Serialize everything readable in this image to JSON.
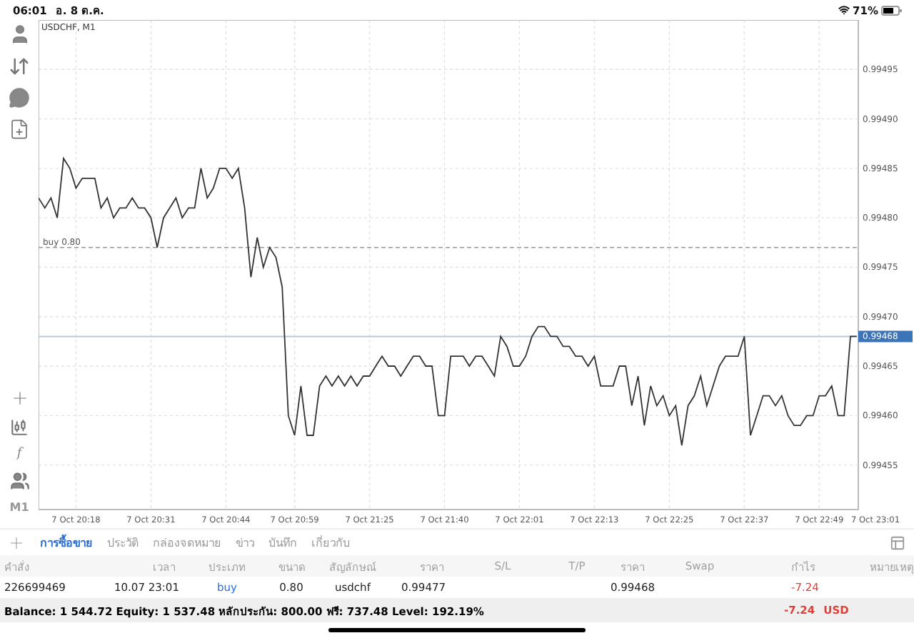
{
  "status_bar": {
    "time": "06:01",
    "date": "อ. 8 ต.ค.",
    "battery": "71%"
  },
  "toolbar": {
    "function_glyph": "f",
    "timeframe": "M1"
  },
  "chart": {
    "chart_data": {
      "type": "line",
      "title": "USDCHF, M1",
      "grid": true,
      "ylim": [
        0.994505,
        0.995
      ],
      "categories": [
        null,
        null,
        null,
        null,
        null,
        null,
        "7 Oct 20:18",
        null,
        null,
        null,
        null,
        null,
        null,
        null,
        null,
        null,
        null,
        null,
        "7 Oct 20:31",
        null,
        null,
        null,
        null,
        null,
        null,
        null,
        null,
        null,
        null,
        null,
        "7 Oct 20:44",
        null,
        null,
        null,
        null,
        null,
        null,
        null,
        null,
        null,
        null,
        "7 Oct 20:59",
        null,
        null,
        null,
        null,
        null,
        null,
        null,
        null,
        null,
        null,
        null,
        "7 Oct 21:25",
        null,
        null,
        null,
        null,
        null,
        null,
        null,
        null,
        null,
        null,
        null,
        "7 Oct 21:40",
        null,
        null,
        null,
        null,
        null,
        null,
        null,
        null,
        null,
        null,
        null,
        "7 Oct 22:01",
        null,
        null,
        null,
        null,
        null,
        null,
        null,
        null,
        null,
        null,
        null,
        "7 Oct 22:13",
        null,
        null,
        null,
        null,
        null,
        null,
        null,
        null,
        null,
        null,
        null,
        "7 Oct 22:25",
        null,
        null,
        null,
        null,
        null,
        null,
        null,
        null,
        null,
        null,
        null,
        "7 Oct 22:37",
        null,
        null,
        null,
        null,
        null,
        null,
        null,
        null,
        null,
        null,
        null,
        "7 Oct 22:49",
        null,
        null,
        null,
        null,
        null,
        null,
        null,
        null,
        "7 Oct 23:01"
      ],
      "yticks": [
        {
          "value": 0.99455,
          "label": "0.99455"
        },
        {
          "value": 0.9946,
          "label": "0.99460"
        },
        {
          "value": 0.99465,
          "label": "0.99465"
        },
        {
          "value": 0.9947,
          "label": "0.99470"
        },
        {
          "value": 0.99475,
          "label": "0.99475"
        },
        {
          "value": 0.9948,
          "label": "0.99480"
        },
        {
          "value": 0.99485,
          "label": "0.99485"
        },
        {
          "value": 0.9949,
          "label": "0.99490"
        },
        {
          "value": 0.99495,
          "label": "0.99495"
        }
      ],
      "series": [
        {
          "color": "#333333",
          "values": [
            0.99482,
            0.99481,
            0.99482,
            0.9948,
            0.99486,
            0.99485,
            0.99483,
            0.99484,
            0.99484,
            0.99484,
            0.99481,
            0.99482,
            0.9948,
            0.99481,
            0.99481,
            0.99482,
            0.99481,
            0.99481,
            0.9948,
            0.99477,
            0.9948,
            0.99481,
            0.99482,
            0.9948,
            0.99481,
            0.99481,
            0.99485,
            0.99482,
            0.99483,
            0.99485,
            0.99485,
            0.99484,
            0.99485,
            0.99481,
            0.99474,
            0.99478,
            0.99475,
            0.99477,
            0.99476,
            0.99473,
            0.9946,
            0.99458,
            0.99463,
            0.99458,
            0.99458,
            0.99463,
            0.99464,
            0.99463,
            0.99464,
            0.99463,
            0.99464,
            0.99463,
            0.99464,
            0.99464,
            0.99465,
            0.99466,
            0.99465,
            0.99465,
            0.99464,
            0.99465,
            0.99466,
            0.99466,
            0.99465,
            0.99465,
            0.9946,
            0.9946,
            0.99466,
            0.99466,
            0.99466,
            0.99465,
            0.99466,
            0.99466,
            0.99465,
            0.99464,
            0.99468,
            0.99467,
            0.99465,
            0.99465,
            0.99466,
            0.99468,
            0.99469,
            0.99469,
            0.99468,
            0.99468,
            0.99467,
            0.99467,
            0.99466,
            0.99466,
            0.99465,
            0.99466,
            0.99463,
            0.99463,
            0.99463,
            0.99465,
            0.99465,
            0.99461,
            0.99464,
            0.99459,
            0.99463,
            0.99461,
            0.99462,
            0.9946,
            0.99461,
            0.99457,
            0.99461,
            0.99462,
            0.99464,
            0.99461,
            0.99463,
            0.99465,
            0.99466,
            0.99466,
            0.99466,
            0.99468,
            0.99458,
            0.9946,
            0.99462,
            0.99462,
            0.99461,
            0.99462,
            0.9946,
            0.99459,
            0.99459,
            0.9946,
            0.9946,
            0.99462,
            0.99462,
            0.99463,
            0.9946,
            0.9946,
            0.99468,
            0.99468,
            null,
            null,
            null
          ]
        }
      ],
      "ref_lines": [
        {
          "axis": "y",
          "value": 0.99477,
          "label": "buy 0.80"
        },
        {
          "axis": "y",
          "value": 0.99468,
          "label": "0.99468"
        }
      ]
    }
  },
  "tabs": [
    {
      "label": "การซื้อขาย",
      "selected": true
    },
    {
      "label": "ประวัติ",
      "selected": false
    },
    {
      "label": "กล่องจดหมาย",
      "selected": false
    },
    {
      "label": "ข่าว",
      "selected": false
    },
    {
      "label": "บันทึก",
      "selected": false
    },
    {
      "label": "เกี่ยวกับ",
      "selected": false
    }
  ],
  "table": {
    "columns": [
      "คำสั่ง",
      "เวลา",
      "ประเภท",
      "ขนาด",
      "สัญลักษณ์",
      "ราคา",
      "S/L",
      "T/P",
      "ราคา",
      "Swap",
      "กำไร",
      "หมายเหตุ"
    ],
    "rows": [
      [
        "226699469",
        "10.07 23:01",
        "buy",
        "0.80",
        "usdchf",
        "0.99477",
        "",
        "",
        "0.99468",
        "",
        "-7.24",
        ""
      ]
    ]
  },
  "summary": {
    "text": "Balance: 1 544.72 Equity: 1 537.48 หลักประกัน: 800.00 ฟรี: 737.48 Level: 192.19%",
    "profit": "-7.24",
    "currency": "USD"
  }
}
